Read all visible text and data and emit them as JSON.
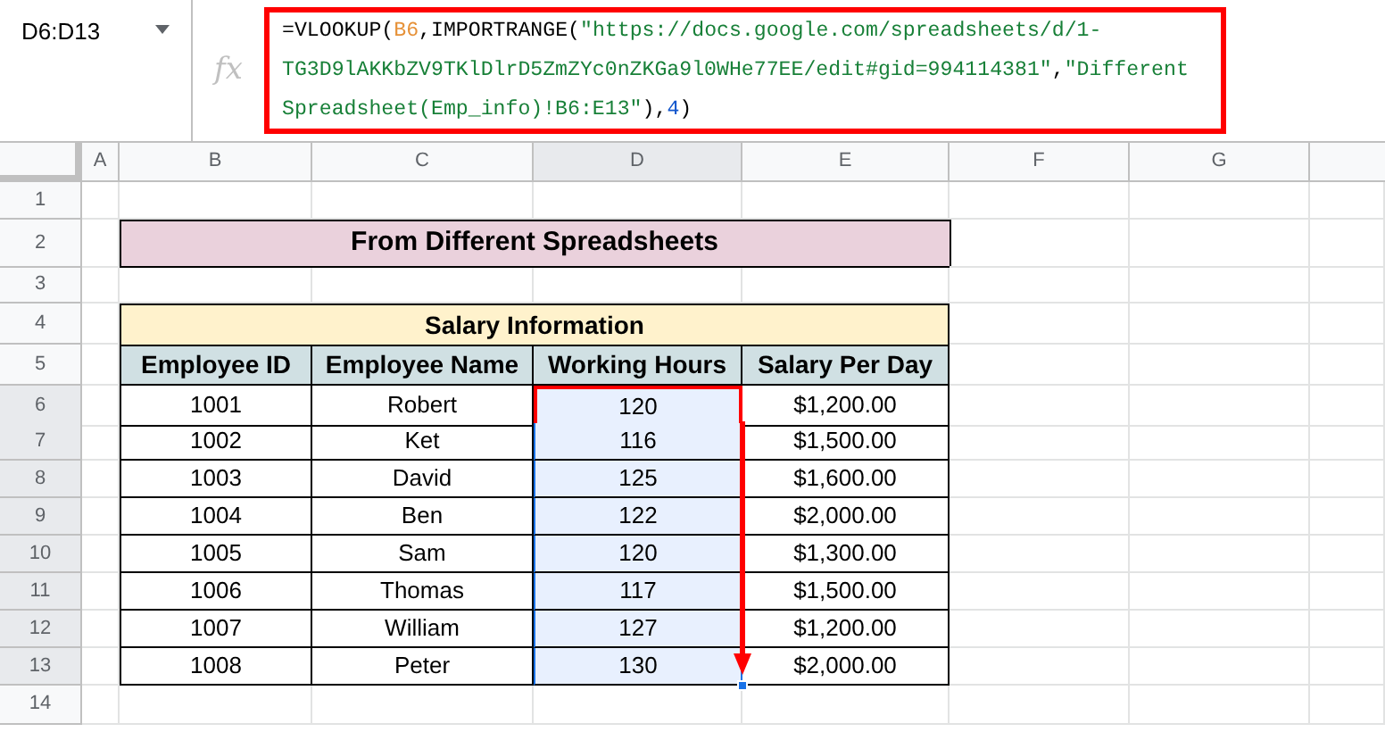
{
  "name_box": {
    "value": "D6:D13"
  },
  "formula_bar": {
    "icon_text": "fx",
    "lines": [
      [
        {
          "kind": "plain",
          "text": "=VLOOKUP("
        },
        {
          "kind": "ref",
          "text": "B6"
        },
        {
          "kind": "plain",
          "text": ",IMPORTRANGE("
        },
        {
          "kind": "string",
          "text": "\"https://docs.google.com/spreadsheets/d/1-"
        }
      ],
      [
        {
          "kind": "string",
          "text": "TG3D9lAKKbZV9TKlDlrD5ZmZYc0nZKGa9l0WHe77EE/edit#gid=994114381\""
        },
        {
          "kind": "plain",
          "text": ","
        },
        {
          "kind": "string",
          "text": "\"Different"
        }
      ],
      [
        {
          "kind": "string",
          "text": "Spreadsheet(Emp_info)!B6:E13\""
        },
        {
          "kind": "plain",
          "text": "),"
        },
        {
          "kind": "number",
          "text": "4"
        },
        {
          "kind": "plain",
          "text": ")"
        }
      ]
    ]
  },
  "columns": [
    {
      "label": "A",
      "selected": false
    },
    {
      "label": "B",
      "selected": false
    },
    {
      "label": "C",
      "selected": false
    },
    {
      "label": "D",
      "selected": true
    },
    {
      "label": "E",
      "selected": false
    },
    {
      "label": "F",
      "selected": false
    },
    {
      "label": "G",
      "selected": false
    }
  ],
  "row_numbers": [
    {
      "label": "1",
      "selected": false
    },
    {
      "label": "2",
      "selected": false
    },
    {
      "label": "3",
      "selected": false
    },
    {
      "label": "4",
      "selected": false
    },
    {
      "label": "5",
      "selected": false
    },
    {
      "label": "6",
      "selected": true
    },
    {
      "label": "7",
      "selected": true
    },
    {
      "label": "8",
      "selected": true
    },
    {
      "label": "9",
      "selected": true
    },
    {
      "label": "10",
      "selected": true
    },
    {
      "label": "11",
      "selected": true
    },
    {
      "label": "12",
      "selected": true
    },
    {
      "label": "13",
      "selected": true
    },
    {
      "label": "14",
      "selected": false
    }
  ],
  "sheet": {
    "title": "From Different Spreadsheets",
    "subtitle": "Salary Information",
    "headers": [
      "Employee ID",
      "Employee Name",
      "Working Hours",
      "Salary Per Day"
    ],
    "rows": [
      {
        "cells": [
          "1001",
          "Robert",
          "120",
          "$1,200.00"
        ],
        "selected": true,
        "active": true
      },
      {
        "cells": [
          "1002",
          "Ket",
          "116",
          "$1,500.00"
        ],
        "selected": true,
        "active": false
      },
      {
        "cells": [
          "1003",
          "David",
          "125",
          "$1,600.00"
        ],
        "selected": true,
        "active": false
      },
      {
        "cells": [
          "1004",
          "Ben",
          "122",
          "$2,000.00"
        ],
        "selected": true,
        "active": false
      },
      {
        "cells": [
          "1005",
          "Sam",
          "120",
          "$1,300.00"
        ],
        "selected": true,
        "active": false
      },
      {
        "cells": [
          "1006",
          "Thomas",
          "117",
          "$1,500.00"
        ],
        "selected": true,
        "active": false
      },
      {
        "cells": [
          "1007",
          "William",
          "127",
          "$1,200.00"
        ],
        "selected": true,
        "active": false
      },
      {
        "cells": [
          "1008",
          "Peter",
          "130",
          "$2,000.00"
        ],
        "selected": true,
        "active": false
      }
    ]
  }
}
